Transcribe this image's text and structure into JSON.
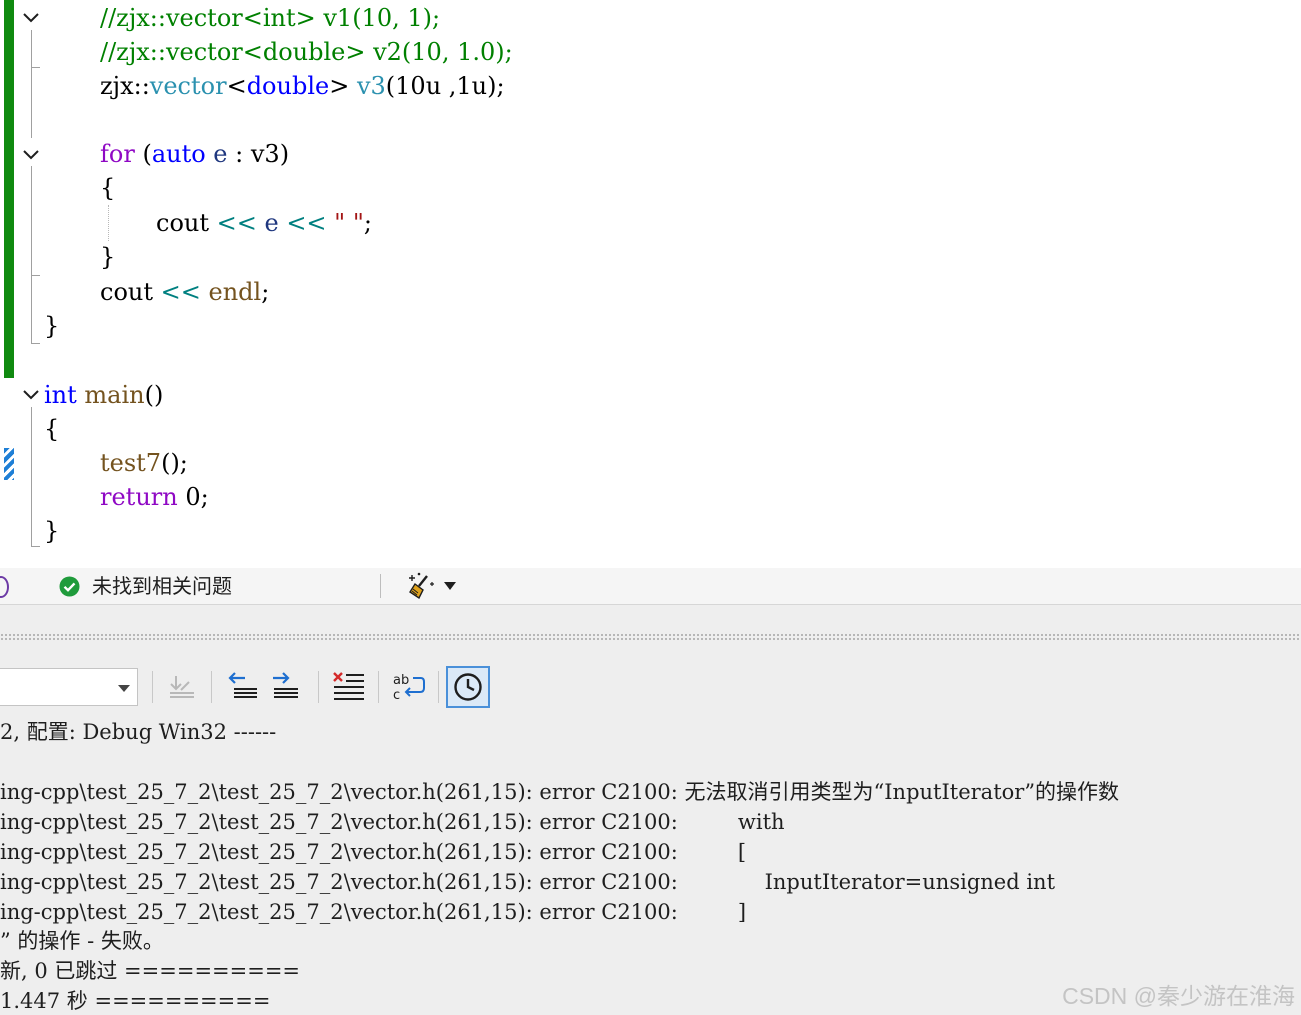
{
  "editor": {
    "lines": [
      [
        "//zjx::vector<int> v1(10, 1);"
      ],
      [
        "//zjx::vector<double> v2(10, 1.0);"
      ],
      [
        "zjx",
        "::",
        "vector",
        "<",
        "double",
        ">",
        " v3",
        "(",
        "10u ,1u",
        ");"
      ],
      [
        "for",
        " (",
        "auto",
        " e",
        " : ",
        "v3",
        ")"
      ],
      [
        "{"
      ],
      [
        "cout",
        " << ",
        "e",
        " << ",
        "\" \"",
        ";"
      ],
      [
        "}"
      ],
      [
        "cout",
        " << ",
        "endl",
        ";"
      ],
      [
        "}"
      ],
      [
        "int",
        " ",
        "main",
        "()"
      ],
      [
        "{"
      ],
      [
        "test7",
        "();"
      ],
      [
        "return",
        " 0;"
      ],
      [
        "}"
      ]
    ]
  },
  "status": {
    "message": "未找到相关问题",
    "ok_icon": "check-circle-icon",
    "cleanup_icon": "broom-sparkle-icon"
  },
  "toolbar": {
    "source_value": "",
    "buttons": [
      {
        "name": "find-message-in-code-icon",
        "enabled": false
      },
      {
        "name": "go-to-previous-message-icon",
        "enabled": true
      },
      {
        "name": "go-to-next-message-icon",
        "enabled": true
      },
      {
        "name": "clear-all-icon",
        "enabled": true
      },
      {
        "name": "toggle-word-wrap-icon",
        "enabled": true
      },
      {
        "name": "show-timestamps-icon",
        "enabled": true,
        "active": true
      }
    ]
  },
  "output": {
    "lines": [
      "2, 配置: Debug Win32 ------",
      "",
      "ing-cpp\\test_25_7_2\\test_25_7_2\\vector.h(261,15): error C2100: 无法取消引用类型为“InputIterator”的操作数",
      "ing-cpp\\test_25_7_2\\test_25_7_2\\vector.h(261,15): error C2100:         with",
      "ing-cpp\\test_25_7_2\\test_25_7_2\\vector.h(261,15): error C2100:         [",
      "ing-cpp\\test_25_7_2\\test_25_7_2\\vector.h(261,15): error C2100:             InputIterator=unsigned int",
      "ing-cpp\\test_25_7_2\\test_25_7_2\\vector.h(261,15): error C2100:         ]",
      "” 的操作 - 失败。",
      "新, 0 已跳过 ==========",
      "1.447 秒 =========="
    ]
  },
  "watermark": "CSDN @秦少游在淮海",
  "colors": {
    "change_bar": "#108a10",
    "comment": "#008000",
    "keyword": "#8f08c4",
    "type_keyword": "#0000ff",
    "type": "#2b91af",
    "active_border": "#4a90d9"
  }
}
